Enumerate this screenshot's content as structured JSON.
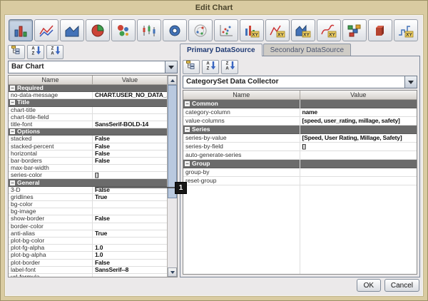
{
  "window": {
    "title": "Edit Chart"
  },
  "chart_type_toolbar": {
    "icons": [
      {
        "name": "bar-chart",
        "selected": true
      },
      {
        "name": "line-chart",
        "selected": false
      },
      {
        "name": "area-chart",
        "selected": false
      },
      {
        "name": "pie-chart",
        "selected": false
      },
      {
        "name": "bubble-chart",
        "selected": false
      },
      {
        "name": "stock-chart",
        "selected": false
      },
      {
        "name": "ring-chart",
        "selected": false
      },
      {
        "name": "polar-chart",
        "selected": false
      },
      {
        "name": "scatter-chart",
        "selected": false
      },
      {
        "name": "xy-bar-chart",
        "selected": false
      },
      {
        "name": "xy-line-chart",
        "selected": false
      },
      {
        "name": "xy-area-chart",
        "selected": false
      },
      {
        "name": "xy-spline-chart",
        "selected": false
      },
      {
        "name": "block-chart",
        "selected": false
      },
      {
        "name": "stacked-3d-chart",
        "selected": false
      },
      {
        "name": "xy-step-chart",
        "selected": false
      }
    ]
  },
  "left_panel": {
    "toolbar_icons": [
      "categorize",
      "sort-ascending",
      "sort-descending"
    ],
    "chart_type_combo": "Bar Chart",
    "columns": [
      "Name",
      "Value"
    ],
    "rows": [
      {
        "section": "Required"
      },
      {
        "name": "no-data-message",
        "value": "CHART.USER_NO_DATA_..."
      },
      {
        "section": "Title"
      },
      {
        "name": "chart-title",
        "value": ""
      },
      {
        "name": "chart-title-field",
        "value": ""
      },
      {
        "name": "title-font",
        "value": "SansSerif-BOLD-14"
      },
      {
        "section": "Options"
      },
      {
        "name": "stacked",
        "value": "False"
      },
      {
        "name": "stacked-percent",
        "value": "False"
      },
      {
        "name": "horizontal",
        "value": "False"
      },
      {
        "name": "bar-borders",
        "value": "False"
      },
      {
        "name": "max-bar-width",
        "value": ""
      },
      {
        "name": "series-color",
        "value": "[]"
      },
      {
        "section": "General"
      },
      {
        "name": "3-D",
        "value": "False"
      },
      {
        "name": "gridlines",
        "value": "True"
      },
      {
        "name": "bg-color",
        "value": ""
      },
      {
        "name": "bg-image",
        "value": ""
      },
      {
        "name": "show-border",
        "value": "False"
      },
      {
        "name": "border-color",
        "value": ""
      },
      {
        "name": "anti-alias",
        "value": "True"
      },
      {
        "name": "plot-bg-color",
        "value": ""
      },
      {
        "name": "plot-fg-alpha",
        "value": "1.0"
      },
      {
        "name": "plot-bg-alpha",
        "value": "1.0"
      },
      {
        "name": "plot-border",
        "value": "False"
      },
      {
        "name": "label-font",
        "value": "SansSerif--8"
      },
      {
        "name": "url-formula",
        "value": ""
      }
    ]
  },
  "right_panel": {
    "toolbar_icons": [
      "categorize",
      "sort-ascending",
      "sort-descending"
    ],
    "tabs": [
      {
        "label": "Primary DataSource",
        "active": true
      },
      {
        "label": "Secondary DataSource",
        "active": false
      }
    ],
    "collector_combo": "CategorySet Data Collector",
    "columns": [
      "Name",
      "Value"
    ],
    "rows": [
      {
        "section": "Common"
      },
      {
        "name": "category-column",
        "value": "name"
      },
      {
        "name": "value-columns",
        "value": "[speed, user_rating, millage, safety]"
      },
      {
        "section": "Series"
      },
      {
        "name": "series-by-value",
        "value": "[Speed, User Rating, Millage, Safety]"
      },
      {
        "name": "series-by-field",
        "value": "[]"
      },
      {
        "name": "auto-generate-series",
        "value": ""
      },
      {
        "section": "Group"
      },
      {
        "name": "group-by",
        "value": ""
      },
      {
        "name": "reset-group",
        "value": ""
      }
    ]
  },
  "callout": {
    "label": "1"
  },
  "footer": {
    "ok_label": "OK",
    "cancel_label": "Cancel"
  },
  "colors": {
    "frame": "#d9cba1",
    "panel_bg": "#ebe9ea",
    "section_header_bg": "#6b6b6b",
    "active_tab_text": "#1f3a74",
    "scroll_thumb": "#b9c9df",
    "callout_bg": "#161616"
  }
}
